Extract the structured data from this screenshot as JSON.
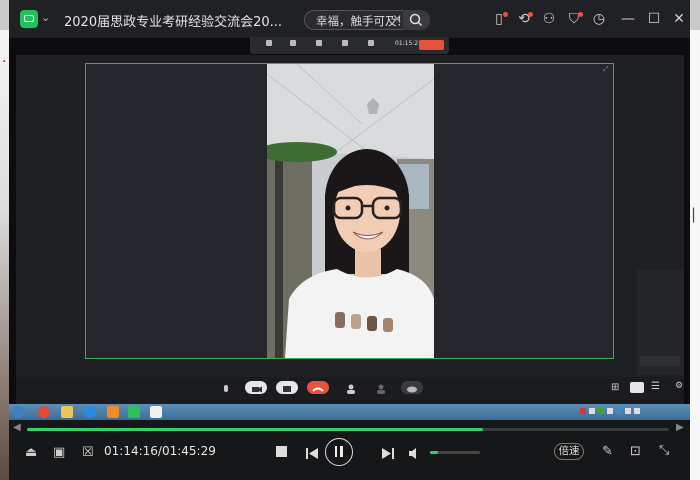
{
  "window": {
    "title": "2020届思政专业考研经验交流会20...",
    "search": {
      "value": "幸福，触手可及！"
    }
  },
  "player": {
    "current_time": "01:14:16",
    "separator": "/",
    "duration": "01:45:29",
    "progress_fraction": 0.71,
    "volume_fraction": 0.15,
    "speed_label": "倍速"
  },
  "meeting": {
    "timer": "01:15:21"
  },
  "icons": [
    "app-logo-icon",
    "chevron-down-icon",
    "clear-icon",
    "search-icon",
    "notes-icon",
    "cast-icon",
    "share-icon",
    "shirt-icon",
    "history-icon",
    "minimize-icon",
    "maximize-icon",
    "close-icon",
    "playlist-icon",
    "subtitle-icon",
    "chat-icon",
    "stop-icon",
    "prev-icon",
    "pause-icon",
    "next-icon",
    "volume-icon",
    "screenshot-icon",
    "toolbox-icon",
    "fullscreen-icon"
  ],
  "colors": {
    "accent": "#2fd16b",
    "speaker_border": "#3da95a",
    "end_call": "#e5533c"
  }
}
